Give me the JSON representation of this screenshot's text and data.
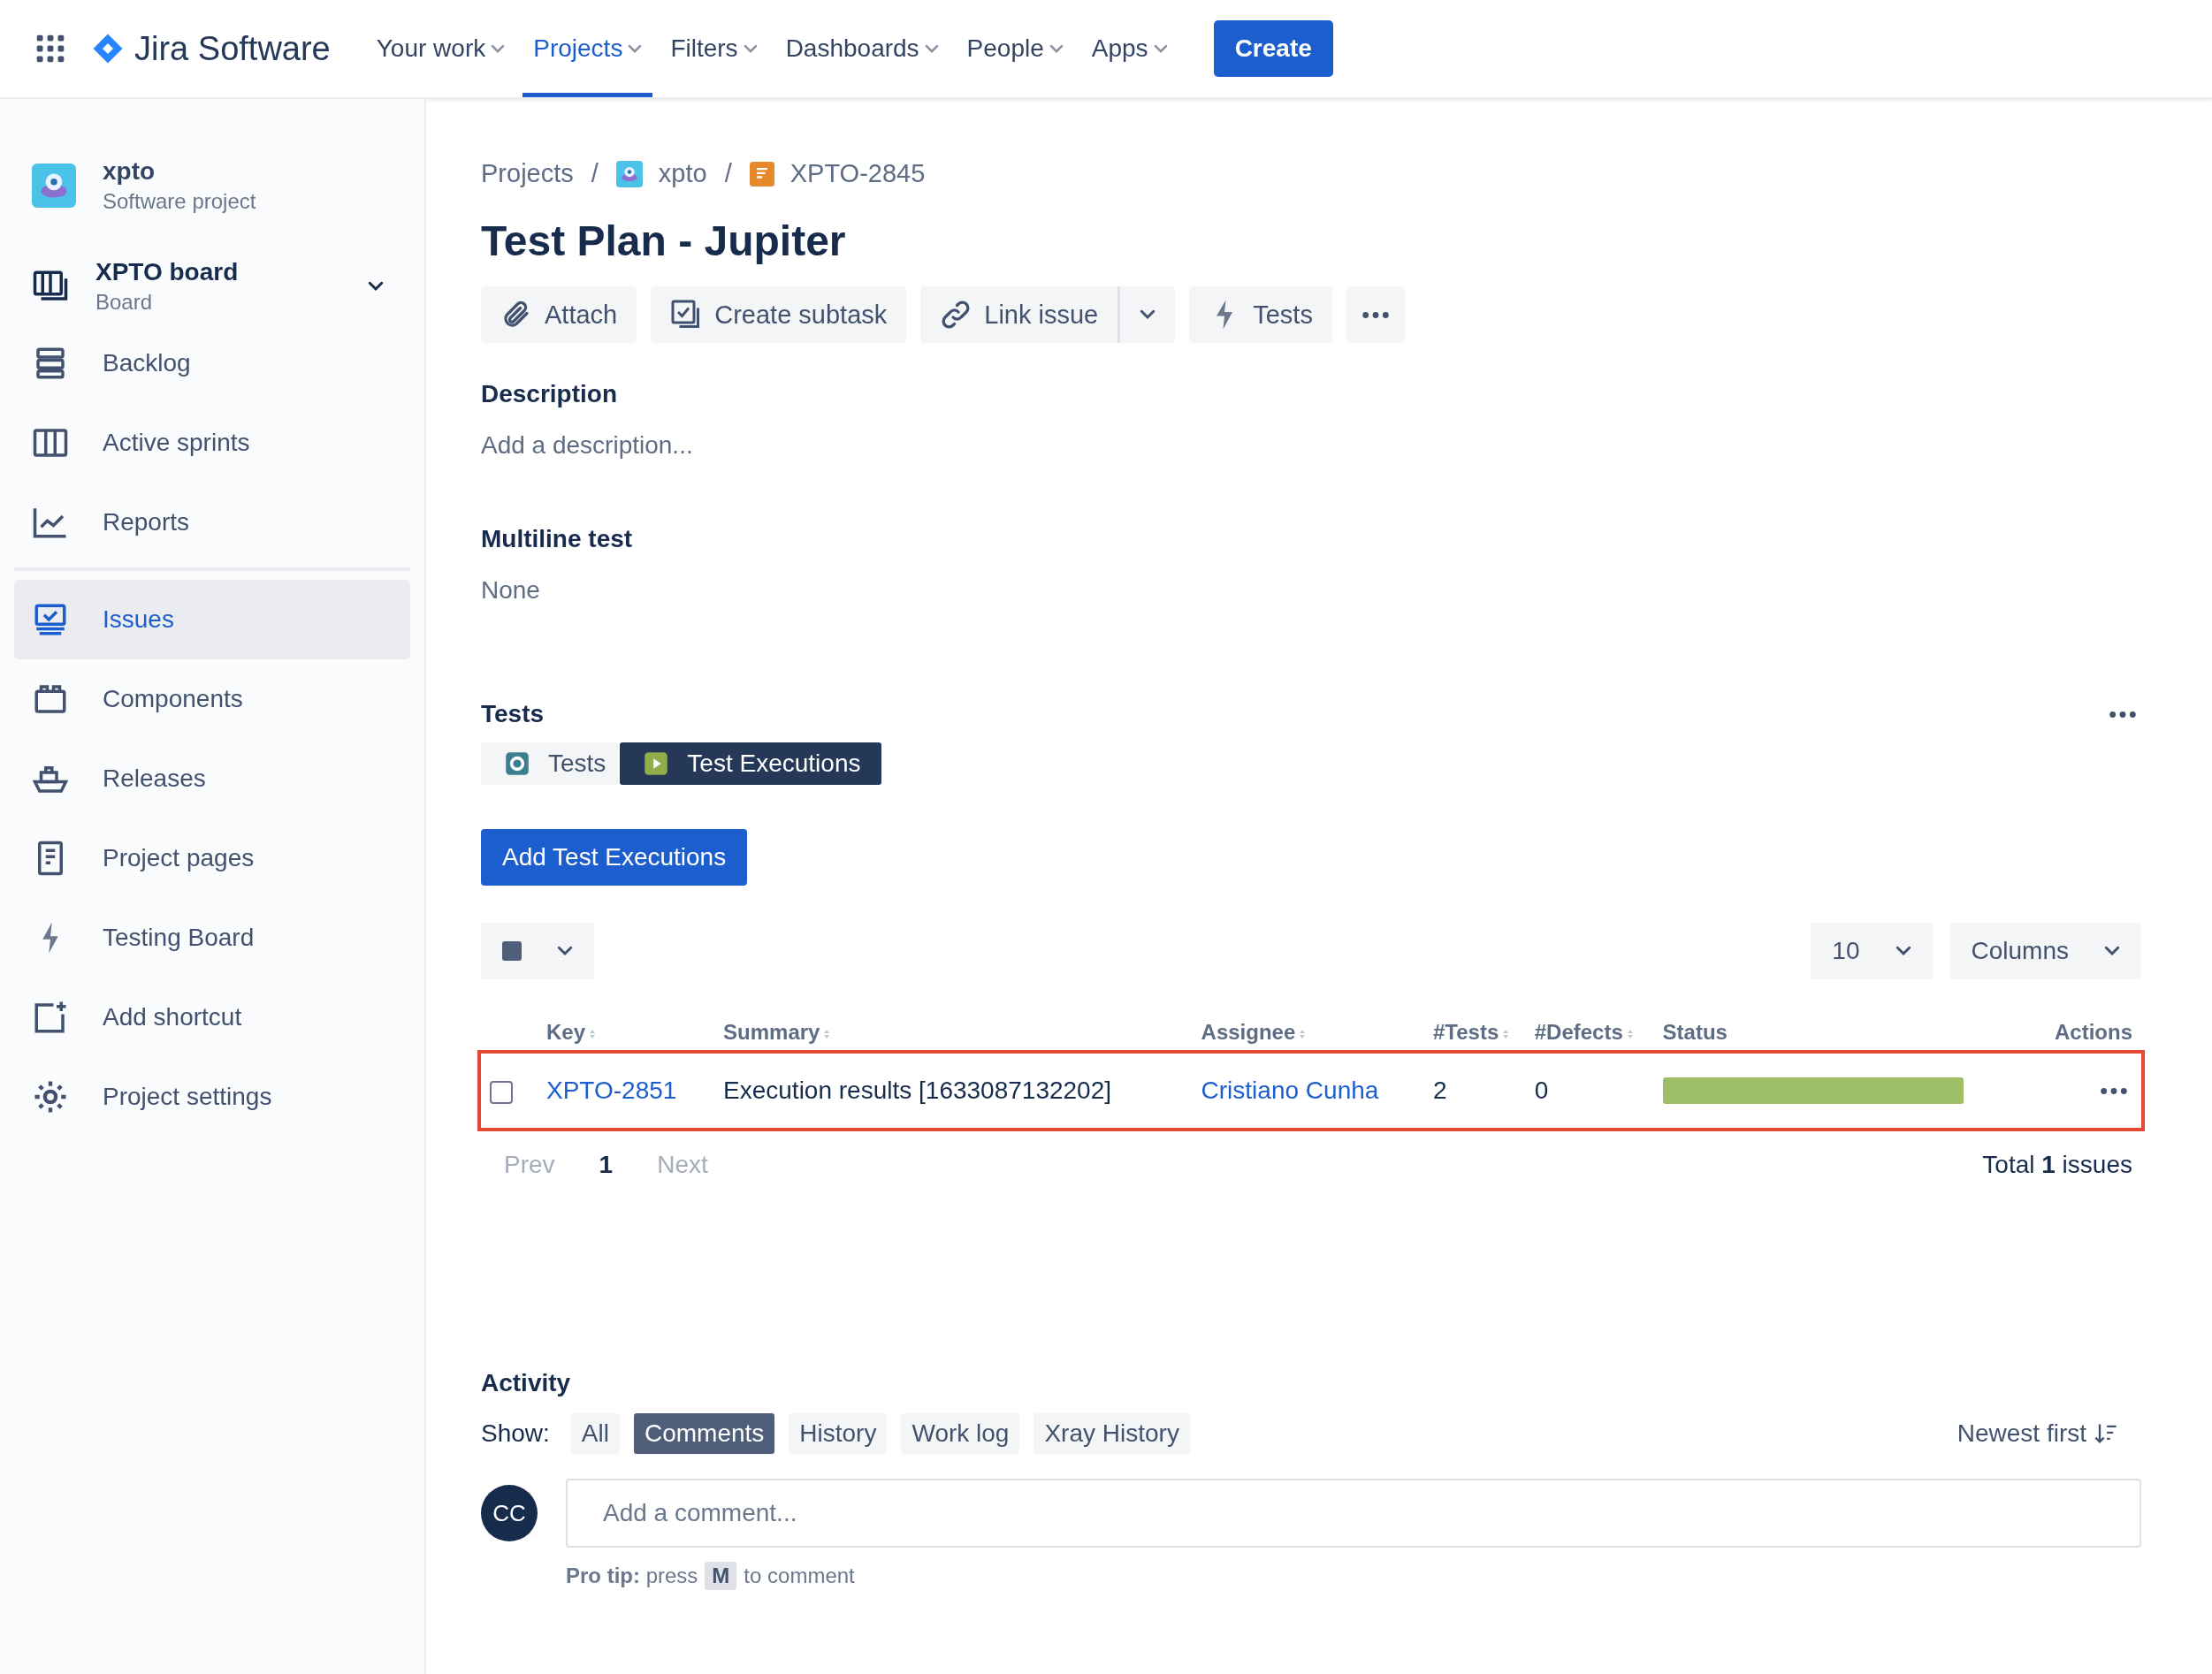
{
  "nav": {
    "app_name": "Jira Software",
    "items": [
      {
        "label": "Your work",
        "selected": false
      },
      {
        "label": "Projects",
        "selected": true
      },
      {
        "label": "Filters",
        "selected": false
      },
      {
        "label": "Dashboards",
        "selected": false
      },
      {
        "label": "People",
        "selected": false
      },
      {
        "label": "Apps",
        "selected": false
      }
    ],
    "create_button": "Create"
  },
  "sidebar": {
    "project": {
      "name": "xpto",
      "type": "Software project"
    },
    "board": {
      "name": "XPTO board",
      "subtitle": "Board"
    },
    "items": [
      {
        "label": "Backlog",
        "kind": "backlog",
        "selected": false
      },
      {
        "label": "Active sprints",
        "kind": "sprints",
        "selected": false
      },
      {
        "label": "Reports",
        "kind": "reports",
        "selected": false
      },
      {
        "label": "Issues",
        "kind": "issues",
        "selected": true
      },
      {
        "label": "Components",
        "kind": "components",
        "selected": false
      },
      {
        "label": "Releases",
        "kind": "releases",
        "selected": false
      },
      {
        "label": "Project pages",
        "kind": "pages",
        "selected": false
      },
      {
        "label": "Testing Board",
        "kind": "bolt",
        "selected": false
      },
      {
        "label": "Add shortcut",
        "kind": "shortcut",
        "selected": false
      },
      {
        "label": "Project settings",
        "kind": "settings",
        "selected": false
      }
    ]
  },
  "breadcrumb_separator": "/",
  "breadcrumb": [
    {
      "label": "Projects",
      "kind": "text"
    },
    {
      "label": "xpto",
      "kind": "project"
    },
    {
      "label": "XPTO-2845",
      "kind": "issue"
    }
  ],
  "title": "Test Plan - Jupiter",
  "toolbar": [
    {
      "label": "Attach",
      "kind": "attach"
    },
    {
      "label": "Create subtask",
      "kind": "subtask"
    },
    {
      "label": "Link issue",
      "kind": "link"
    },
    {
      "label": "Tests",
      "kind": "bolt"
    },
    {
      "kind": "more"
    }
  ],
  "fields": [
    {
      "label": "Description",
      "value": "Add a description..."
    },
    {
      "label": "Multiline test",
      "value": "None"
    }
  ],
  "tests": {
    "title": "Tests",
    "tabs": [
      {
        "label": "Tests",
        "selected": false
      },
      {
        "label": "Test Executions",
        "selected": true
      }
    ],
    "add_button": "Add Test Executions",
    "page_size": "10",
    "columns_button": "Columns",
    "columns": [
      {
        "label": "Key",
        "sortable": true
      },
      {
        "label": "Summary",
        "sortable": true
      },
      {
        "label": "Assignee",
        "sortable": true
      },
      {
        "label": "#Tests",
        "sortable": true
      },
      {
        "label": "#Defects",
        "sortable": true
      },
      {
        "label": "Status",
        "sortable": false
      },
      {
        "label": "Actions",
        "sortable": false
      }
    ],
    "rows": [
      {
        "checked": false,
        "highlighted": true,
        "key": "XPTO-2851",
        "summary": "Execution results [1633087132202]",
        "assignee": "Cristiano Cunha",
        "tests": "2",
        "defects": "0",
        "status": {
          "level": 1,
          "color": "#9cbf68"
        }
      }
    ],
    "pagination": {
      "prev": "Prev",
      "page": "1",
      "next": "Next",
      "total": "Total **1** issues"
    }
  },
  "activity": {
    "title": "Activity",
    "show_label": "Show:",
    "filters": [
      {
        "label": "All",
        "selected": false
      },
      {
        "label": "Comments",
        "selected": true
      },
      {
        "label": "History",
        "selected": false
      },
      {
        "label": "Work log",
        "selected": false
      },
      {
        "label": "Xray History",
        "selected": false
      }
    ],
    "sort": "Newest first",
    "avatar": "CC",
    "comment_placeholder": "Add a comment...",
    "pro_tip": {
      "prefix": "**Pro tip:** press",
      "key": "M",
      "suffix": "to comment"
    }
  }
}
